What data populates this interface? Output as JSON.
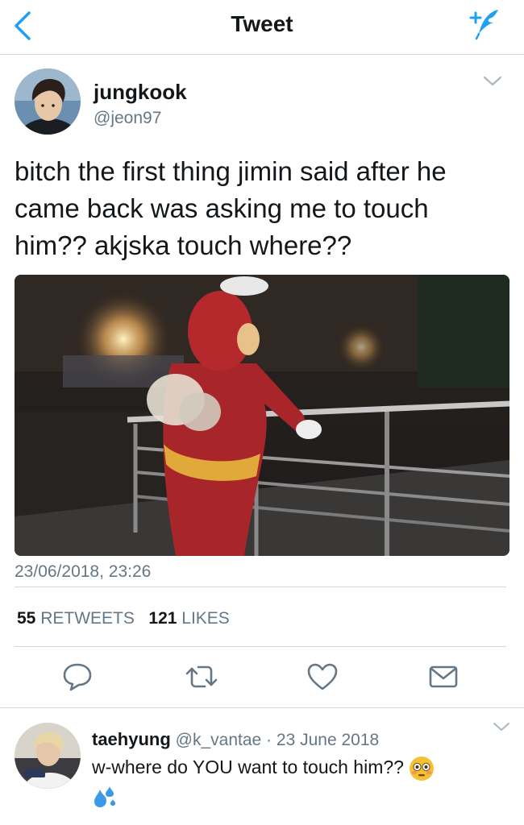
{
  "nav": {
    "title": "Tweet"
  },
  "tweet": {
    "author_name": "jungkook",
    "author_handle": "@jeon97",
    "text": "bitch the first thing jimin said after he came back was asking me to touch him?? akjska touch where??",
    "timestamp": "23/06/2018, 23:26",
    "retweets_count": "55",
    "retweets_label": "RETWEETS",
    "likes_count": "121",
    "likes_label": "LIKES"
  },
  "reply": {
    "author_name": "taehyung",
    "author_handle": "@k_vantae",
    "separator": "·",
    "date": "23 June 2018",
    "text": "w-where do YOU want to touch him??"
  },
  "colors": {
    "accent": "#1da1f2",
    "secondary_text": "#657786",
    "primary_text": "#14171a",
    "divider": "#d4d9de"
  },
  "icons": {
    "back": "chevron-left-icon",
    "compose": "compose-feather-icon",
    "more": "chevron-down-icon",
    "reply": "reply-bubble-icon",
    "retweet": "retweet-icon",
    "like": "heart-icon",
    "share": "envelope-icon"
  }
}
